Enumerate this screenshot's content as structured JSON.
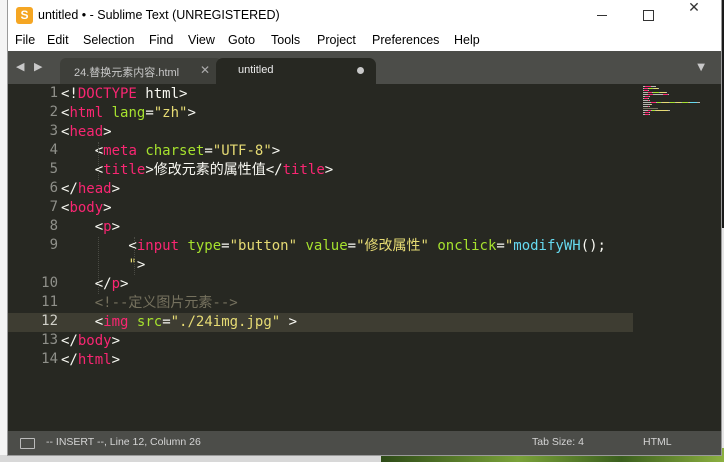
{
  "window": {
    "title": "untitled • - Sublime Text (UNREGISTERED)",
    "app_icon_glyph": "S",
    "controls": {
      "minimize": "",
      "maximize": "",
      "close": "✕"
    }
  },
  "menu": [
    "File",
    "Edit",
    "Selection",
    "Find",
    "View",
    "Goto",
    "Tools",
    "Project",
    "Preferences",
    "Help"
  ],
  "tabs": {
    "nav": "◀ ▶",
    "items": [
      {
        "label": "24.替换元素内容.html",
        "close": "✕",
        "active": false
      },
      {
        "label": "untitled",
        "active": true,
        "dirty": true
      }
    ],
    "dropdown": "▼"
  },
  "editor": {
    "line_numbers": [
      "1",
      "2",
      "3",
      "4",
      "5",
      "6",
      "7",
      "8",
      "9",
      "",
      "10",
      "11",
      "12",
      "13",
      "14"
    ],
    "current_line": "12",
    "lines": [
      [
        [
          "plain",
          "<!"
        ],
        [
          "tag",
          "DOCTYPE"
        ],
        [
          "plain",
          " html>"
        ]
      ],
      [
        [
          "plain",
          "<"
        ],
        [
          "tag",
          "html"
        ],
        [
          "plain",
          " "
        ],
        [
          "attr",
          "lang"
        ],
        [
          "plain",
          "="
        ],
        [
          "str",
          "\"zh\""
        ],
        [
          "plain",
          ">"
        ]
      ],
      [
        [
          "plain",
          "<"
        ],
        [
          "tag",
          "head"
        ],
        [
          "plain",
          ">"
        ]
      ],
      [
        [
          "plain",
          "    <"
        ],
        [
          "tag",
          "meta"
        ],
        [
          "plain",
          " "
        ],
        [
          "attr",
          "charset"
        ],
        [
          "plain",
          "="
        ],
        [
          "str",
          "\"UTF-8\""
        ],
        [
          "plain",
          ">"
        ]
      ],
      [
        [
          "plain",
          "    <"
        ],
        [
          "tag",
          "title"
        ],
        [
          "plain",
          ">修改元素的属性值</"
        ],
        [
          "tag",
          "title"
        ],
        [
          "plain",
          ">"
        ]
      ],
      [
        [
          "plain",
          "</"
        ],
        [
          "tag",
          "head"
        ],
        [
          "plain",
          ">"
        ]
      ],
      [
        [
          "plain",
          "<"
        ],
        [
          "tag",
          "body"
        ],
        [
          "plain",
          ">"
        ]
      ],
      [
        [
          "plain",
          "    <"
        ],
        [
          "tag",
          "p"
        ],
        [
          "plain",
          ">"
        ]
      ],
      [
        [
          "plain",
          "        <"
        ],
        [
          "tag",
          "input"
        ],
        [
          "plain",
          " "
        ],
        [
          "attr",
          "type"
        ],
        [
          "plain",
          "="
        ],
        [
          "str",
          "\"button\""
        ],
        [
          "plain",
          " "
        ],
        [
          "attr",
          "value"
        ],
        [
          "plain",
          "="
        ],
        [
          "str",
          "\"修改属性\""
        ],
        [
          "plain",
          " "
        ],
        [
          "attr",
          "onclick"
        ],
        [
          "plain",
          "="
        ],
        [
          "str",
          "\""
        ],
        [
          "fn",
          "modifyWH"
        ],
        [
          "plain",
          "();"
        ]
      ],
      [
        [
          "plain",
          "        "
        ],
        [
          "str",
          "\""
        ],
        [
          "plain",
          ">"
        ]
      ],
      [
        [
          "plain",
          "    </"
        ],
        [
          "tag",
          "p"
        ],
        [
          "plain",
          ">"
        ]
      ],
      [
        [
          "cm",
          "    <!--定义图片元素-->"
        ]
      ],
      [
        [
          "plain",
          "    <"
        ],
        [
          "tag",
          "img"
        ],
        [
          "plain",
          " "
        ],
        [
          "attr",
          "src"
        ],
        [
          "plain",
          "="
        ],
        [
          "str",
          "\"./24img.jpg\""
        ],
        [
          "plain",
          " >"
        ]
      ],
      [
        [
          "plain",
          "</"
        ],
        [
          "tag",
          "body"
        ],
        [
          "plain",
          ">"
        ]
      ],
      [
        [
          "plain",
          "</"
        ],
        [
          "tag",
          "html"
        ],
        [
          "plain",
          ">"
        ]
      ]
    ]
  },
  "status": {
    "mode": "-- INSERT --, Line 12, Column 26",
    "tab_size": "Tab Size: 4",
    "syntax": "HTML"
  },
  "colors": {
    "background": "#272822",
    "tag": "#f92672",
    "attribute": "#a6e22e",
    "string": "#e6db74",
    "function": "#66d9ef",
    "comment": "#75715e",
    "text": "#f8f8f2"
  }
}
